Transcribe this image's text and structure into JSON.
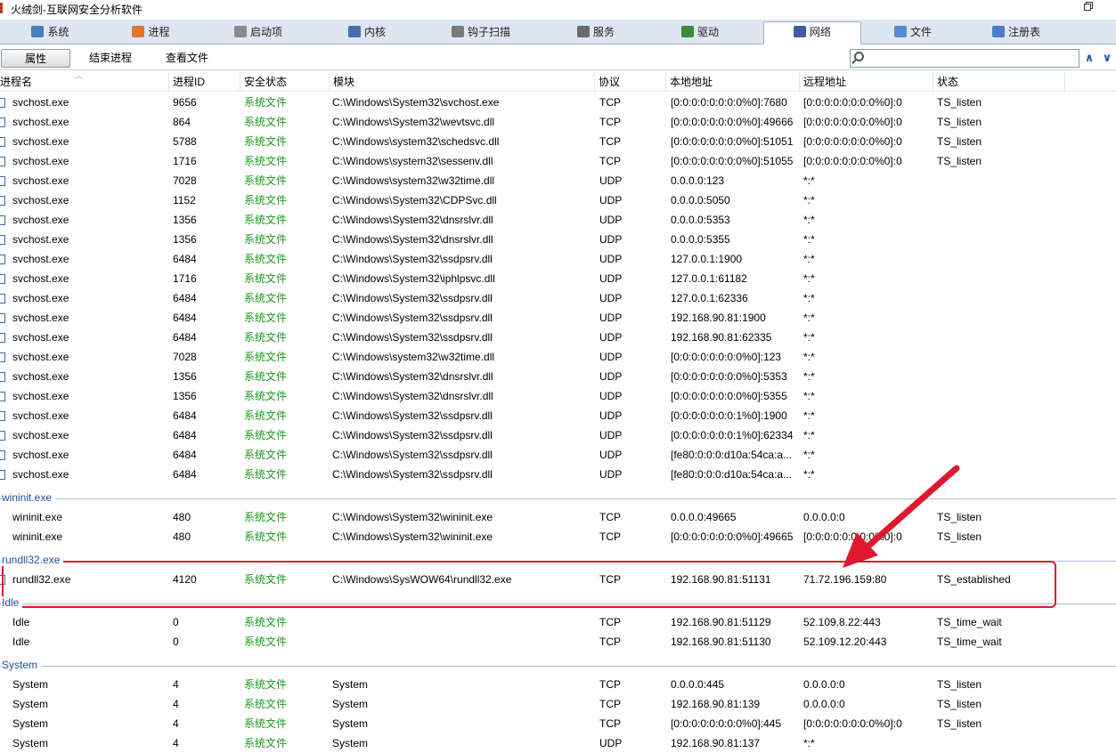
{
  "window": {
    "title": "火绒剑-互联网安全分析软件"
  },
  "tabs": [
    {
      "label": "系统",
      "icon": "monitor-icon",
      "active": false
    },
    {
      "label": "进程",
      "icon": "windows-logo-icon",
      "active": false
    },
    {
      "label": "启动项",
      "icon": "gear-icon",
      "active": false
    },
    {
      "label": "内核",
      "icon": "wrench-icon",
      "active": false
    },
    {
      "label": "钩子扫描",
      "icon": "hook-scan-icon",
      "active": false
    },
    {
      "label": "服务",
      "icon": "service-icon",
      "active": false
    },
    {
      "label": "驱动",
      "icon": "driver-icon",
      "active": false
    },
    {
      "label": "网络",
      "icon": "network-icon",
      "active": true
    },
    {
      "label": "文件",
      "icon": "file-icon",
      "active": false
    },
    {
      "label": "注册表",
      "icon": "registry-icon",
      "active": false
    }
  ],
  "toolbar": {
    "properties": "属性",
    "end_process": "结束进程",
    "view_file": "查看文件"
  },
  "search": {
    "value": ""
  },
  "columns": [
    "进程名",
    "进程ID",
    "安全状态",
    "模块",
    "协议",
    "本地地址",
    "远程地址",
    "状态"
  ],
  "groups": [
    {
      "name": "",
      "rows": [
        [
          "svchost.exe",
          "9656",
          "系统文件",
          "C:\\Windows\\System32\\svchost.exe",
          "TCP",
          "[0:0:0:0:0:0:0:0%0]:7680",
          "[0:0:0:0:0:0:0:0%0]:0",
          "TS_listen"
        ],
        [
          "svchost.exe",
          "864",
          "系统文件",
          "C:\\Windows\\System32\\wevtsvc.dll",
          "TCP",
          "[0:0:0:0:0:0:0:0%0]:49666",
          "[0:0:0:0:0:0:0:0%0]:0",
          "TS_listen"
        ],
        [
          "svchost.exe",
          "5788",
          "系统文件",
          "C:\\Windows\\system32\\schedsvc.dll",
          "TCP",
          "[0:0:0:0:0:0:0:0%0]:51051",
          "[0:0:0:0:0:0:0:0%0]:0",
          "TS_listen"
        ],
        [
          "svchost.exe",
          "1716",
          "系统文件",
          "C:\\Windows\\system32\\sessenv.dll",
          "TCP",
          "[0:0:0:0:0:0:0:0%0]:51055",
          "[0:0:0:0:0:0:0:0%0]:0",
          "TS_listen"
        ],
        [
          "svchost.exe",
          "7028",
          "系统文件",
          "C:\\Windows\\system32\\w32time.dll",
          "UDP",
          "0.0.0.0:123",
          "*:*",
          ""
        ],
        [
          "svchost.exe",
          "1152",
          "系统文件",
          "C:\\Windows\\System32\\CDPSvc.dll",
          "UDP",
          "0.0.0.0:5050",
          "*:*",
          ""
        ],
        [
          "svchost.exe",
          "1356",
          "系统文件",
          "C:\\Windows\\System32\\dnsrslvr.dll",
          "UDP",
          "0.0.0.0:5353",
          "*:*",
          ""
        ],
        [
          "svchost.exe",
          "1356",
          "系统文件",
          "C:\\Windows\\System32\\dnsrslvr.dll",
          "UDP",
          "0.0.0.0:5355",
          "*:*",
          ""
        ],
        [
          "svchost.exe",
          "6484",
          "系统文件",
          "C:\\Windows\\System32\\ssdpsrv.dll",
          "UDP",
          "127.0.0.1:1900",
          "*:*",
          ""
        ],
        [
          "svchost.exe",
          "1716",
          "系统文件",
          "C:\\Windows\\System32\\iphlpsvc.dll",
          "UDP",
          "127.0.0.1:61182",
          "*:*",
          ""
        ],
        [
          "svchost.exe",
          "6484",
          "系统文件",
          "C:\\Windows\\System32\\ssdpsrv.dll",
          "UDP",
          "127.0.0.1:62336",
          "*:*",
          ""
        ],
        [
          "svchost.exe",
          "6484",
          "系统文件",
          "C:\\Windows\\System32\\ssdpsrv.dll",
          "UDP",
          "192.168.90.81:1900",
          "*:*",
          ""
        ],
        [
          "svchost.exe",
          "6484",
          "系统文件",
          "C:\\Windows\\System32\\ssdpsrv.dll",
          "UDP",
          "192.168.90.81:62335",
          "*:*",
          ""
        ],
        [
          "svchost.exe",
          "7028",
          "系统文件",
          "C:\\Windows\\system32\\w32time.dll",
          "UDP",
          "[0:0:0:0:0:0:0:0%0]:123",
          "*:*",
          ""
        ],
        [
          "svchost.exe",
          "1356",
          "系统文件",
          "C:\\Windows\\System32\\dnsrslvr.dll",
          "UDP",
          "[0:0:0:0:0:0:0:0%0]:5353",
          "*:*",
          ""
        ],
        [
          "svchost.exe",
          "1356",
          "系统文件",
          "C:\\Windows\\System32\\dnsrslvr.dll",
          "UDP",
          "[0:0:0:0:0:0:0:0%0]:5355",
          "*:*",
          ""
        ],
        [
          "svchost.exe",
          "6484",
          "系统文件",
          "C:\\Windows\\System32\\ssdpsrv.dll",
          "UDP",
          "[0:0:0:0:0:0:0:1%0]:1900",
          "*:*",
          ""
        ],
        [
          "svchost.exe",
          "6484",
          "系统文件",
          "C:\\Windows\\System32\\ssdpsrv.dll",
          "UDP",
          "[0:0:0:0:0:0:0:1%0]:62334",
          "*:*",
          ""
        ],
        [
          "svchost.exe",
          "6484",
          "系统文件",
          "C:\\Windows\\System32\\ssdpsrv.dll",
          "UDP",
          "[fe80:0:0:0:d10a:54ca:a...",
          "*:*",
          ""
        ],
        [
          "svchost.exe",
          "6484",
          "系统文件",
          "C:\\Windows\\System32\\ssdpsrv.dll",
          "UDP",
          "[fe80:0:0:0:d10a:54ca:a...",
          "*:*",
          ""
        ]
      ]
    },
    {
      "name": "wininit.exe",
      "rows": [
        [
          "wininit.exe",
          "480",
          "系统文件",
          "C:\\Windows\\System32\\wininit.exe",
          "TCP",
          "0.0.0.0:49665",
          "0.0.0.0:0",
          "TS_listen"
        ],
        [
          "wininit.exe",
          "480",
          "系统文件",
          "C:\\Windows\\System32\\wininit.exe",
          "TCP",
          "[0:0:0:0:0:0:0:0%0]:49665",
          "[0:0:0:0:0:0:0:0%0]:0",
          "TS_listen"
        ]
      ]
    },
    {
      "name": "rundll32.exe",
      "rows": [
        [
          "rundll32.exe",
          "4120",
          "系统文件",
          "C:\\Windows\\SysWOW64\\rundll32.exe",
          "TCP",
          "192.168.90.81:51131",
          "71.72.196.159:80",
          "TS_established"
        ]
      ]
    },
    {
      "name": "Idle",
      "rows": [
        [
          "Idle",
          "0",
          "系统文件",
          "",
          "TCP",
          "192.168.90.81:51129",
          "52.109.8.22:443",
          "TS_time_wait"
        ],
        [
          "Idle",
          "0",
          "系统文件",
          "",
          "TCP",
          "192.168.90.81:51130",
          "52.109.12.20:443",
          "TS_time_wait"
        ]
      ]
    },
    {
      "name": "System",
      "rows": [
        [
          "System",
          "4",
          "系统文件",
          "System",
          "TCP",
          "0.0.0.0:445",
          "0.0.0.0:0",
          "TS_listen"
        ],
        [
          "System",
          "4",
          "系统文件",
          "System",
          "TCP",
          "192.168.90.81:139",
          "0.0.0.0:0",
          "TS_listen"
        ],
        [
          "System",
          "4",
          "系统文件",
          "System",
          "TCP",
          "[0:0:0:0:0:0:0:0%0]:445",
          "[0:0:0:0:0:0:0:0%0]:0",
          "TS_listen"
        ],
        [
          "System",
          "4",
          "系统文件",
          "System",
          "UDP",
          "192.168.90.81:137",
          "*:*",
          ""
        ]
      ]
    }
  ],
  "annotation": {
    "highlight_color": "#e0182f"
  }
}
